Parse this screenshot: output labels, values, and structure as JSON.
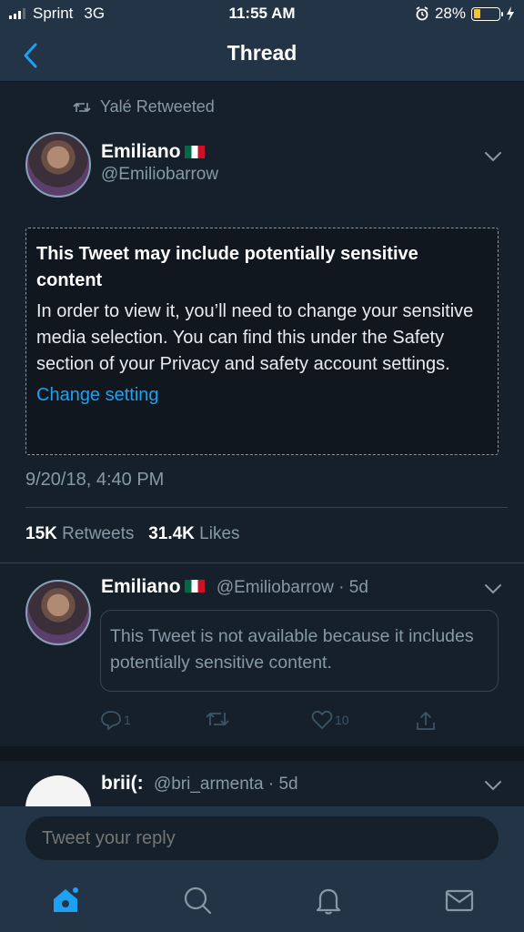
{
  "status_bar": {
    "carrier": "Sprint",
    "network": "3G",
    "time": "11:55 AM",
    "battery": "28%",
    "battery_level": 0.28
  },
  "nav": {
    "title": "Thread"
  },
  "retweet_context": {
    "text": "Yalé Retweeted"
  },
  "main_tweet": {
    "name": "Emiliano",
    "handle": "@Emiliobarrow",
    "sensitive_title": "This Tweet may include potentially sensitive content",
    "sensitive_body": "In order to view it, you’ll need to change your sensitive media selection. You can find this under the Safety section of your Privacy and safety account settings.",
    "change_setting_label": "Change setting",
    "timestamp": "9/20/18, 4:40 PM",
    "retweets_count": "15K",
    "retweets_label": "Retweets",
    "likes_count": "31.4K",
    "likes_label": "Likes"
  },
  "reply_tweet": {
    "name": "Emiliano",
    "handle_time": "@Emiliobarrow · 5d",
    "unavailable_text": "This Tweet is not available because it includes potentially sensitive content.",
    "reply_count": "1",
    "like_count": "10"
  },
  "third_tweet": {
    "name": "brii(:",
    "handle_time": "@bri_armenta · 5d"
  },
  "reply_bar": {
    "placeholder": "Tweet your reply"
  },
  "colors": {
    "background": "#15202b",
    "bar": "#243447",
    "accent": "#1da1f2",
    "muted": "#8899a6"
  },
  "icons": [
    "back-chevron-icon",
    "retweet-icon",
    "chevron-down-icon",
    "reply-icon",
    "like-icon",
    "share-icon",
    "home-icon",
    "search-icon",
    "notifications-icon",
    "messages-icon"
  ]
}
